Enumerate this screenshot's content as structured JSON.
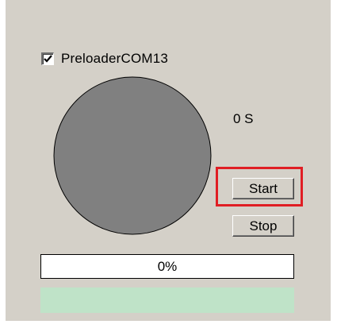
{
  "port": {
    "checked": true,
    "label": "PreloaderCOM13"
  },
  "timer": {
    "text": "0 S"
  },
  "buttons": {
    "start_label": "Start",
    "stop_label": "Stop"
  },
  "progress": {
    "value": 0,
    "text": "0%"
  },
  "colors": {
    "panel": "#d4d0c8",
    "status_circle": "#808080",
    "highlight": "#e01e24",
    "status_strip": "#bfe3c8"
  },
  "icons": {
    "checkbox": "checkmark-icon"
  }
}
